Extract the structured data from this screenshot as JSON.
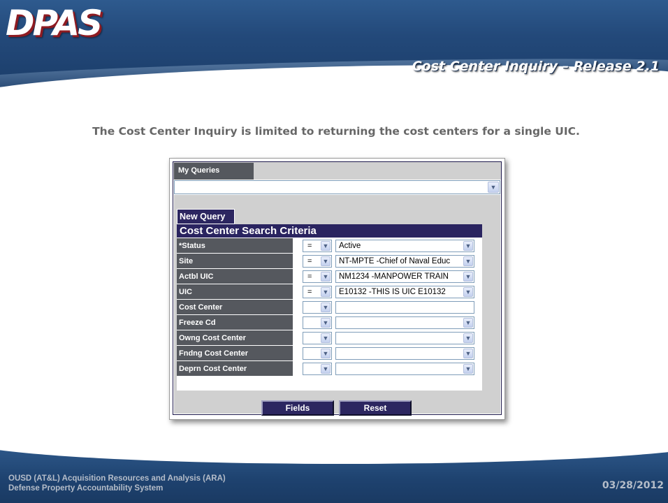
{
  "header": {
    "logo": "DPAS",
    "slide_title": "Cost Center Inquiry – Release 2.1"
  },
  "subtitle": "The Cost Center Inquiry is limited to returning the cost centers for a single UIC.",
  "form": {
    "my_queries_tab": "My Queries",
    "my_queries_value": "",
    "new_query_tab": "New Query",
    "criteria_title": "Cost Center Search Criteria",
    "rows": [
      {
        "label": "*Status",
        "op": "=",
        "value": "Active"
      },
      {
        "label": "Site",
        "op": "=",
        "value": "NT-MPTE -Chief of Naval Educ"
      },
      {
        "label": "Actbl UIC",
        "op": "=",
        "value": "NM1234 -MANPOWER TRAIN"
      },
      {
        "label": "UIC",
        "op": "=",
        "value": "E10132 -THIS IS UIC E10132"
      },
      {
        "label": "Cost Center",
        "op": "",
        "value": ""
      },
      {
        "label": "Freeze Cd",
        "op": "",
        "value": ""
      },
      {
        "label": "Owng Cost Center",
        "op": "",
        "value": ""
      },
      {
        "label": "Fndng Cost Center",
        "op": "",
        "value": ""
      },
      {
        "label": "Deprn Cost Center",
        "op": "",
        "value": ""
      }
    ],
    "fields_button": "Fields",
    "reset_button": "Reset"
  },
  "footer": {
    "line1": "OUSD (AT&L) Acquisition Resources and Analysis (ARA)",
    "line2": "Defense Property Accountability System",
    "date": "03/28/2012"
  },
  "colors": {
    "header_blue": "#23497a",
    "form_navy": "#2a2460",
    "label_gray": "#55585e",
    "panel_gray": "#d0d0d0",
    "logo_shadow_red": "#8e1b22"
  },
  "icons": [
    "chevron-down-icon"
  ]
}
